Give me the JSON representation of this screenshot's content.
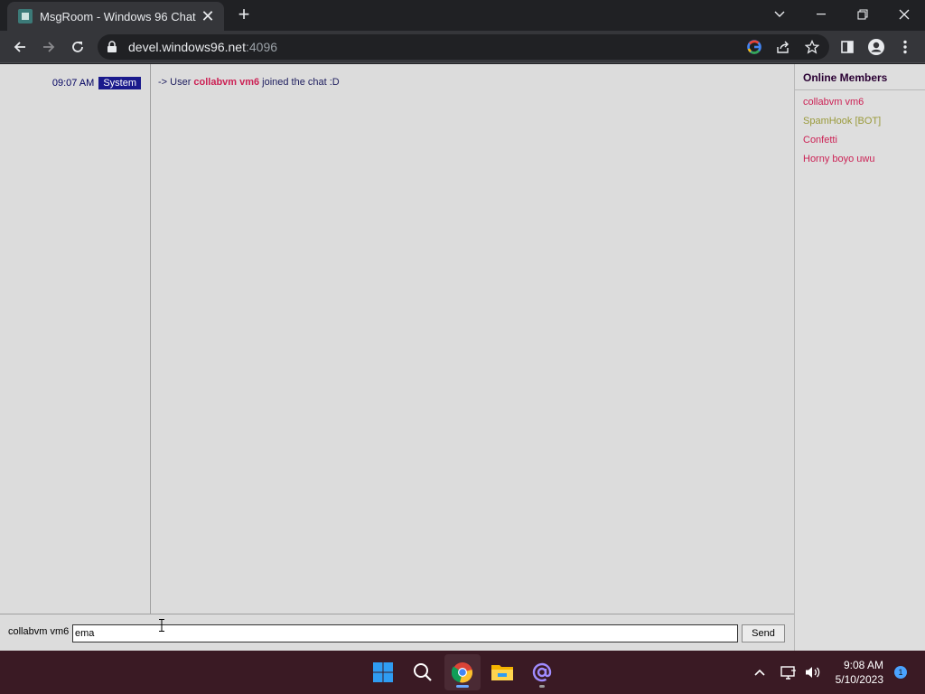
{
  "browser": {
    "tab_title": "MsgRoom - Windows 96 Chat",
    "url_host": "devel.windows96.net",
    "url_port": ":4096"
  },
  "chat": {
    "messages": [
      {
        "time": "09:07 AM",
        "sender_badge": "System",
        "prefix": "-> User",
        "username": "collabvm vm6",
        "suffix": "joined the chat :D"
      }
    ],
    "members_title": "Online Members",
    "members": [
      {
        "name": "collabvm vm6",
        "color": "#cc2255"
      },
      {
        "name": "SpamHook [BOT]",
        "color": "#9a9a3a"
      },
      {
        "name": "Confetti",
        "color": "#cc2255"
      },
      {
        "name": "Horny boyo uwu",
        "color": "#cc2255"
      }
    ],
    "input": {
      "nickname": "collabvm vm6",
      "value": "ema",
      "send_label": "Send"
    }
  },
  "taskbar": {
    "time": "9:08 AM",
    "date": "5/10/2023",
    "notification_count": "1"
  },
  "colors": {
    "page_bg": "#dcdcdc",
    "system_badge": "#1a1a8c",
    "username": "#cc2255",
    "taskbar": "#3a1a24"
  }
}
